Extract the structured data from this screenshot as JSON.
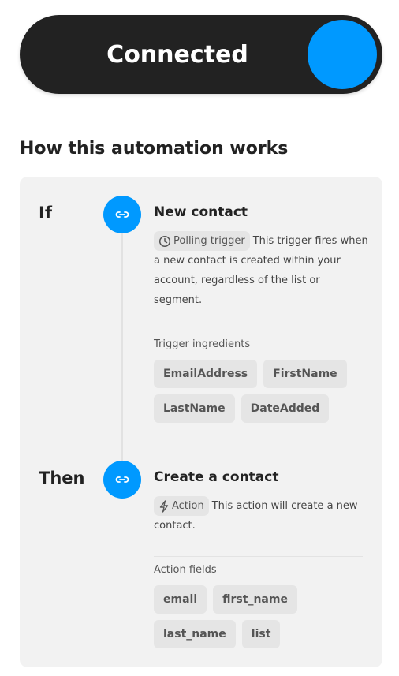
{
  "toggle": {
    "label": "Connected",
    "state": "on",
    "accent": "#0099ff"
  },
  "section_title": "How this automation works",
  "trigger": {
    "keyword": "If",
    "icon": "service-link-icon",
    "title": "New contact",
    "badge": "Polling trigger",
    "badge_icon": "clock-icon",
    "description": "This trigger fires when a new contact is created within your account, regardless of the list or segment.",
    "ingredients_label": "Trigger ingredients",
    "ingredients": [
      "EmailAddress",
      "FirstName",
      "LastName",
      "DateAdded"
    ]
  },
  "action": {
    "keyword": "Then",
    "icon": "service-link-icon",
    "title": "Create a contact",
    "badge": "Action",
    "badge_icon": "bolt-icon",
    "description": "This action will create a new contact.",
    "fields_label": "Action fields",
    "fields": [
      "email",
      "first_name",
      "last_name",
      "list"
    ]
  }
}
